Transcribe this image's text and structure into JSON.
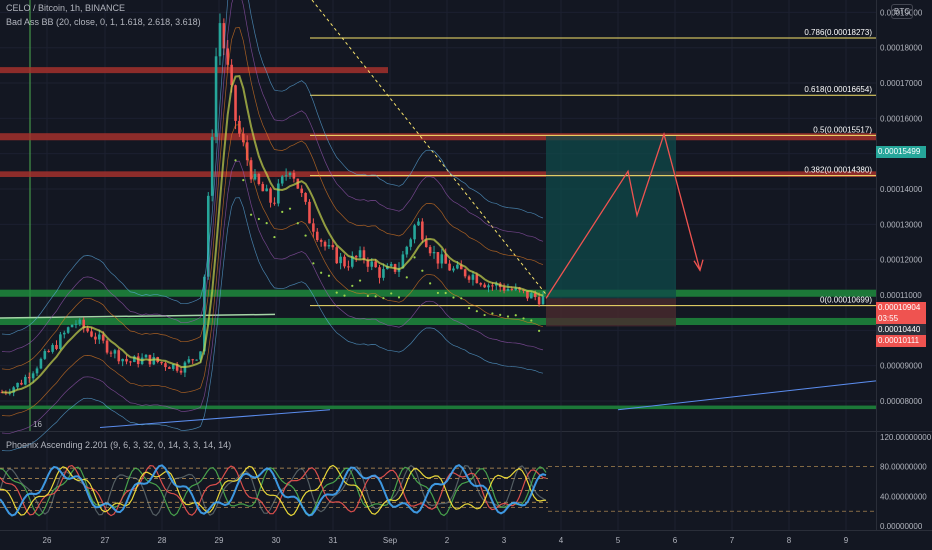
{
  "header": {
    "title": "CELO / Bitcoin, 1h, BINANCE",
    "indicator": "Bad Ass BB (20, close, 0, 1, 1.618, 2.618, 3.618)",
    "currency_badge": "BTC"
  },
  "price_tags": {
    "target": "0.00015499",
    "current": "0.00010904",
    "countdown": "03:55",
    "stop_upper": "0.00010440",
    "stop_lower": "0.00010111"
  },
  "oscillator": {
    "label": "Phoenix Ascending 2.201 (9, 6, 3, 32, 0, 14, 3, 3, 14, 14)",
    "ticks": [
      "120.00000000",
      "80.00000000",
      "40.00000000",
      "0.00000000"
    ],
    "tick_values": [
      120,
      80,
      40,
      0
    ]
  },
  "colors": {
    "background": "#131722",
    "up": "#26a69a",
    "down": "#ef5350",
    "fib": "#f7e36b",
    "resistance_zone": "#a3302b",
    "support_zone": "#1f8a3c",
    "target_box": "#0f4a4a",
    "stop_box": "#4a2a2e",
    "projection": "#ef5350"
  },
  "chart_data": {
    "type": "candlestick",
    "symbol": "CELO / Bitcoin",
    "interval": "1h",
    "exchange": "BINANCE",
    "y_ticks": [
      0.00019,
      0.00018,
      0.00017,
      0.00016,
      0.00015,
      0.00014,
      0.00013,
      0.00012,
      0.00011,
      0.0001,
      9e-05,
      8e-05
    ],
    "y_tick_labels": [
      "0.00019000",
      "0.00018000",
      "0.00017000",
      "0.00016000",
      "0.00015000",
      "0.00014000",
      "0.00013000",
      "0.00012000",
      "0.00011000",
      "0.00010000",
      "0.00009000",
      "0.00008000"
    ],
    "ylim": [
      7.15e-05,
      0.0001935
    ],
    "x_ticks": [
      "26",
      "27",
      "28",
      "29",
      "30",
      "31",
      "Sep",
      "2",
      "3",
      "4",
      "5",
      "6",
      "7",
      "8",
      "9"
    ],
    "fib_levels": [
      {
        "ratio": "0.786",
        "price": 0.00018273,
        "label": "0.786(0.00018273)"
      },
      {
        "ratio": "0.618",
        "price": 0.00016654,
        "label": "0.618(0.00016654)"
      },
      {
        "ratio": "0.5",
        "price": 0.00015517,
        "label": "0.5(0.00015517)"
      },
      {
        "ratio": "0.382",
        "price": 0.0001438,
        "label": "0.382(0.00014380)"
      },
      {
        "ratio": "0",
        "price": 0.00010699,
        "label": "0(0.00010699)"
      }
    ],
    "zones": [
      {
        "kind": "resistance",
        "from": 0.0001728,
        "to": 0.0001745
      },
      {
        "kind": "resistance",
        "from": 0.0001538,
        "to": 0.0001558
      },
      {
        "kind": "resistance",
        "from": 0.0001434,
        "to": 0.000145
      },
      {
        "kind": "support",
        "from": 0.0001095,
        "to": 0.0001115
      },
      {
        "kind": "support",
        "from": 0.0001015,
        "to": 0.0001035
      },
      {
        "kind": "support",
        "from": 7.77e-05,
        "to": 7.87e-05
      }
    ],
    "trade": {
      "entry": 0.00010904,
      "target": 0.00015499,
      "stop": 0.00010111
    },
    "projection": [
      0.00010904,
      0.000145,
      0.0001325,
      0.0001555,
      0.000117
    ],
    "price_path": [
      8.25e-05,
      8.5e-05,
      9.05e-05,
      9.6e-05,
      0.0001025,
      9.9e-05,
      9.45e-05,
      9.1e-05,
      9.2e-05,
      9.05e-05,
      8.95e-05,
      9.4e-05,
      0.00019,
      0.000158,
      0.000142,
      0.000136,
      0.000147,
      0.000132,
      0.000123,
      0.000119,
      0.000121,
      0.000116,
      0.000118,
      0.000131,
      0.000121,
      0.000117,
      0.000116,
      0.000113,
      0.000112,
      0.00011,
      0.000109
    ]
  }
}
